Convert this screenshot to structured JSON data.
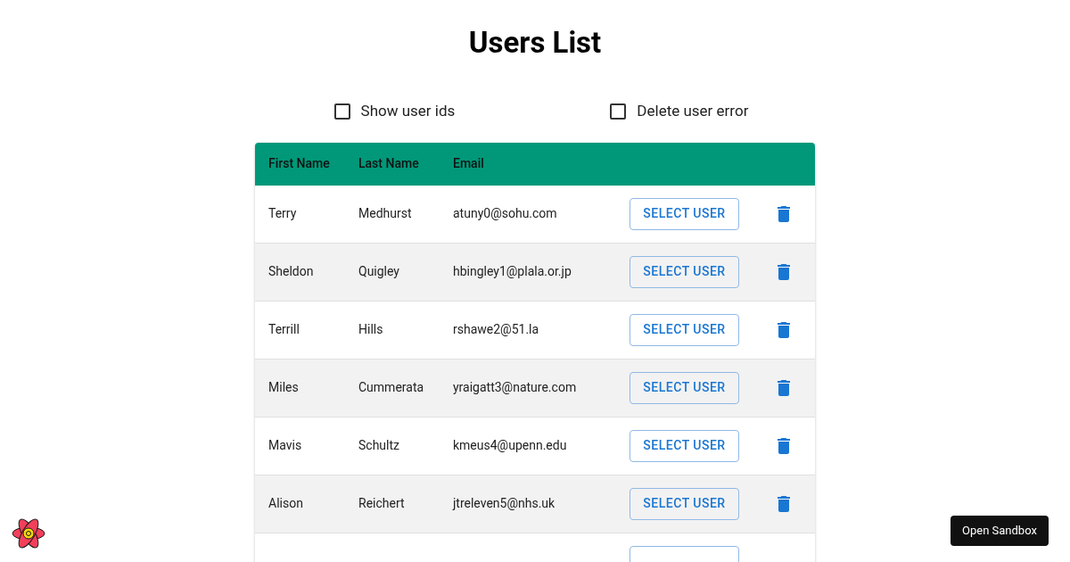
{
  "title": "Users List",
  "options": [
    {
      "label": "Show user ids",
      "checked": false
    },
    {
      "label": "Delete user error",
      "checked": false
    }
  ],
  "table": {
    "columns": [
      "First Name",
      "Last Name",
      "Email"
    ],
    "rows": [
      {
        "first_name": "Terry",
        "last_name": "Medhurst",
        "email": "atuny0@sohu.com",
        "action": "SELECT USER"
      },
      {
        "first_name": "Sheldon",
        "last_name": "Quigley",
        "email": "hbingley1@plala.or.jp",
        "action": "SELECT USER"
      },
      {
        "first_name": "Terrill",
        "last_name": "Hills",
        "email": "rshawe2@51.la",
        "action": "SELECT USER"
      },
      {
        "first_name": "Miles",
        "last_name": "Cummerata",
        "email": "yraigatt3@nature.com",
        "action": "SELECT USER"
      },
      {
        "first_name": "Mavis",
        "last_name": "Schultz",
        "email": "kmeus4@upenn.edu",
        "action": "SELECT USER"
      },
      {
        "first_name": "Alison",
        "last_name": "Reichert",
        "email": "jtreleven5@nhs.uk",
        "action": "SELECT USER"
      }
    ]
  },
  "sandbox_button": "Open Sandbox"
}
